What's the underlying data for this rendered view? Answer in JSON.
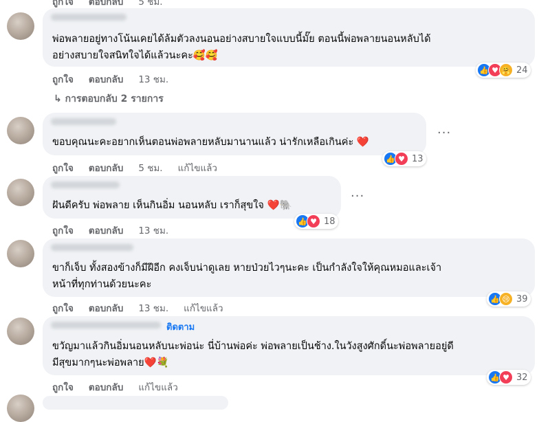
{
  "top_fragment": {
    "like": "ถูกใจ",
    "reply": "ตอบกลับ",
    "time": "5 ชม."
  },
  "comments": [
    {
      "lines": [
        "พ่อพลายอยู่ทางโน้นเคยได้ล้มตัวลงนอนอย่างสบายใจแบบนี้มั๊ย ตอนนี้พ่อพลายนอนหลับได้",
        "อย่างสบายใจสนิทใจได้แล้วนะคะ🥰🥰"
      ],
      "like": "ถูกใจ",
      "reply": "ตอบกลับ",
      "time": "13 ชม.",
      "edited": "",
      "reaction_count": "24",
      "reactions": [
        "like-icon",
        "love-icon",
        "care-icon"
      ],
      "replies_label": "↳ การตอบกลับ 2 รายการ"
    },
    {
      "lines": [
        "ขอบคุณนะคะอยากเห็นตอนพ่อพลายหลับมานานแล้ว น่ารักเหลือเกินค่ะ ❤️"
      ],
      "like": "ถูกใจ",
      "reply": "ตอบกลับ",
      "time": "5 ชม.",
      "edited": "แก้ไขแล้ว",
      "reaction_count": "13",
      "reactions": [
        "like-icon",
        "love-icon"
      ],
      "more": "···"
    },
    {
      "lines": [
        "ฝันดีครับ พ่อพลาย เห็นกินอิ่ม นอนหลับ เราก็สุขใจ ❤️🐘"
      ],
      "like": "ถูกใจ",
      "reply": "ตอบกลับ",
      "time": "13 ชม.",
      "edited": "",
      "reaction_count": "18",
      "reactions": [
        "like-icon",
        "love-icon"
      ],
      "more": "···"
    },
    {
      "lines": [
        "ขาก็เจ็บ ทั้งสองข้างก็มีฝีอีก คงเจ็บน่าดูเลย หายป่วยไวๆนะคะ เป็นกำลังใจให้คุณหมอและเจ้า",
        "หน้าที่ทุกท่านด้วยนะคะ"
      ],
      "like": "ถูกใจ",
      "reply": "ตอบกลับ",
      "time": "13 ชม.",
      "edited": "แก้ไขแล้ว",
      "reaction_count": "39",
      "reactions": [
        "like-icon",
        "sad-icon"
      ]
    },
    {
      "follow": "ติดตาม",
      "lines": [
        "ขวัญมาแล้วกินอิ่มนอนหลับนะพ่อน่ะ นี่บ้านพ่อค่ะ พ่อพลายเป็นช้าง.ในวังสูงศักดิ์นะพ่อพลายอยู่ดี",
        "มีสุขมากๆนะพ่อพลาย❤️💐"
      ],
      "like": "ถูกใจ",
      "reply": "ตอบกลับ",
      "time": "",
      "edited": "แก้ไขแล้ว",
      "reaction_count": "32",
      "reactions": [
        "like-icon",
        "love-icon"
      ]
    }
  ]
}
